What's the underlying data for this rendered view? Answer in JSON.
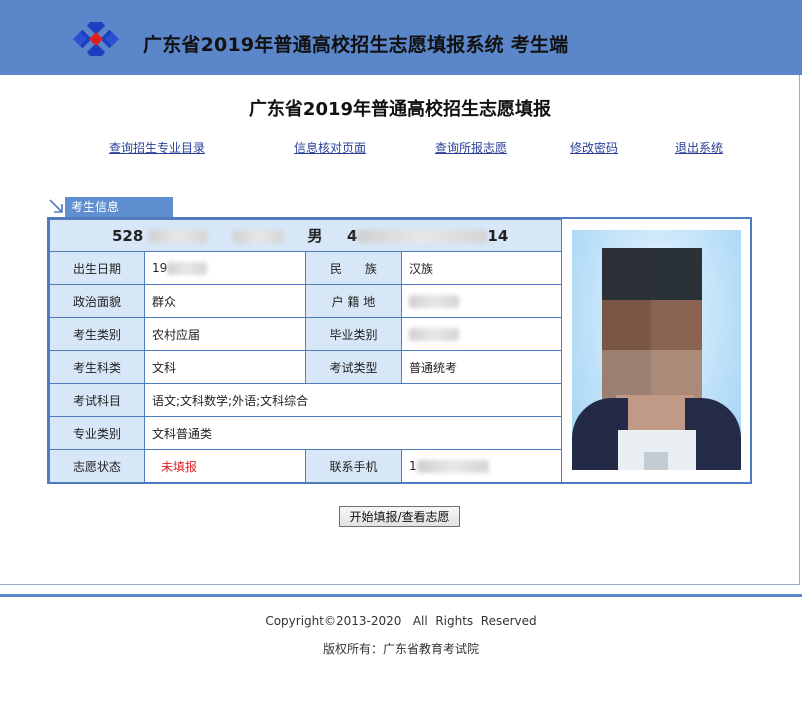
{
  "header": {
    "system_title": "广东省2019年普通高校招生志愿填报系统  考生端",
    "logo_colors": [
      "#1a3fbf",
      "#e0201f"
    ]
  },
  "page": {
    "title": "广东省2019年普通高校招生志愿填报"
  },
  "nav": {
    "items": [
      {
        "label": "查询招生专业目录"
      },
      {
        "label": "信息核对页面"
      },
      {
        "label": "查询所报志愿"
      },
      {
        "label": "修改密码"
      },
      {
        "label": "退出系统"
      }
    ]
  },
  "panel": {
    "tab_label": "考生信息"
  },
  "student": {
    "exam_no_visible_prefix": "528",
    "name_masked": true,
    "gender": "男",
    "id_visible_prefix": "4",
    "id_visible_suffix": "14",
    "birth_label": "出生日期",
    "birth_visible": "19",
    "ethnicity_label": "民      族",
    "ethnicity_value": "汉族",
    "politics_label": "政治面貌",
    "politics_value": "群众",
    "hukou_label": "户 籍 地",
    "category_label": "考生类别",
    "category_value": "农村应届",
    "grad_category_label": "毕业类别",
    "subject_type_label": "考生科类",
    "subject_type_value": "文科",
    "exam_type_label": "考试类型",
    "exam_type_value": "普通统考",
    "subjects_label": "考试科目",
    "subjects_value": "语文;文科数学;外语;文科综合",
    "major_category_label": "专业类别",
    "major_category_value": "文科普通类",
    "status_label": "志愿状态",
    "status_value": "未填报",
    "status_color": "#e02020",
    "phone_label": "联系手机",
    "phone_visible": "1"
  },
  "actions": {
    "start_button": "开始填报/查看志愿"
  },
  "footer": {
    "copyright": "Copyright©2013-2020   All  Rights  Reserved",
    "owner": "版权所有：广东省教育考试院"
  }
}
